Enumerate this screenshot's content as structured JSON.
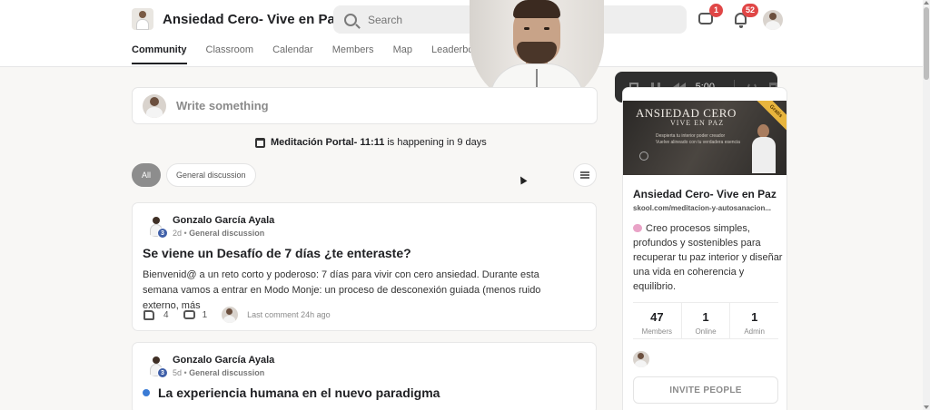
{
  "header": {
    "brand_name": "Ansiedad Cero- Vive en Paz",
    "search_placeholder": "Search",
    "chat_badge": "1",
    "notifications_badge": "52"
  },
  "nav": {
    "tabs": [
      "Community",
      "Classroom",
      "Calendar",
      "Members",
      "Map",
      "Leaderboa"
    ],
    "active": "Community"
  },
  "recorder": {
    "time": "5:00"
  },
  "composer": {
    "placeholder": "Write something"
  },
  "event": {
    "name": "Meditación Portal- 11:11",
    "suffix": "is happening in 9 days"
  },
  "filters": {
    "chips": [
      "All",
      "General discussion"
    ]
  },
  "posts": [
    {
      "author": "Gonzalo García Ayala",
      "level": "3",
      "time": "2d",
      "category": "General discussion",
      "title": "Se viene un Desafío de 7 días ¿te enteraste?",
      "body": "Bienvenid@ a un reto corto y poderoso: 7 días para vivir con cero ansiedad. Durante esta semana vamos a entrar en Modo Monje: un proceso de desconexión guiada (menos ruido externo, más",
      "likes": "4",
      "comments": "1",
      "last_comment": "Last comment 24h ago"
    },
    {
      "author": "Gonzalo García Ayala",
      "level": "3",
      "time": "5d",
      "category": "General discussion",
      "title": "La experiencia humana en el nuevo paradigma"
    }
  ],
  "sidebar": {
    "cover_title": "ANSIEDAD CERO",
    "cover_sub": "VIVE EN PAZ",
    "cover_line1": "Despierta tu interior poder creador",
    "cover_line2": "Vuelve alineado con tu verdadera esencia",
    "cover_ribbon": "Gratis",
    "name": "Ansiedad Cero- Vive en Paz",
    "url": "skool.com/meditacion-y-autosanacion...",
    "description": "Creo procesos simples, profundos y sostenibles para recuperar tu paz interior y diseñar una vida en coherencia y equilibrio.",
    "stats": [
      {
        "value": "47",
        "label": "Members"
      },
      {
        "value": "1",
        "label": "Online"
      },
      {
        "value": "1",
        "label": "Admin"
      }
    ],
    "invite_label": "INVITE PEOPLE"
  }
}
